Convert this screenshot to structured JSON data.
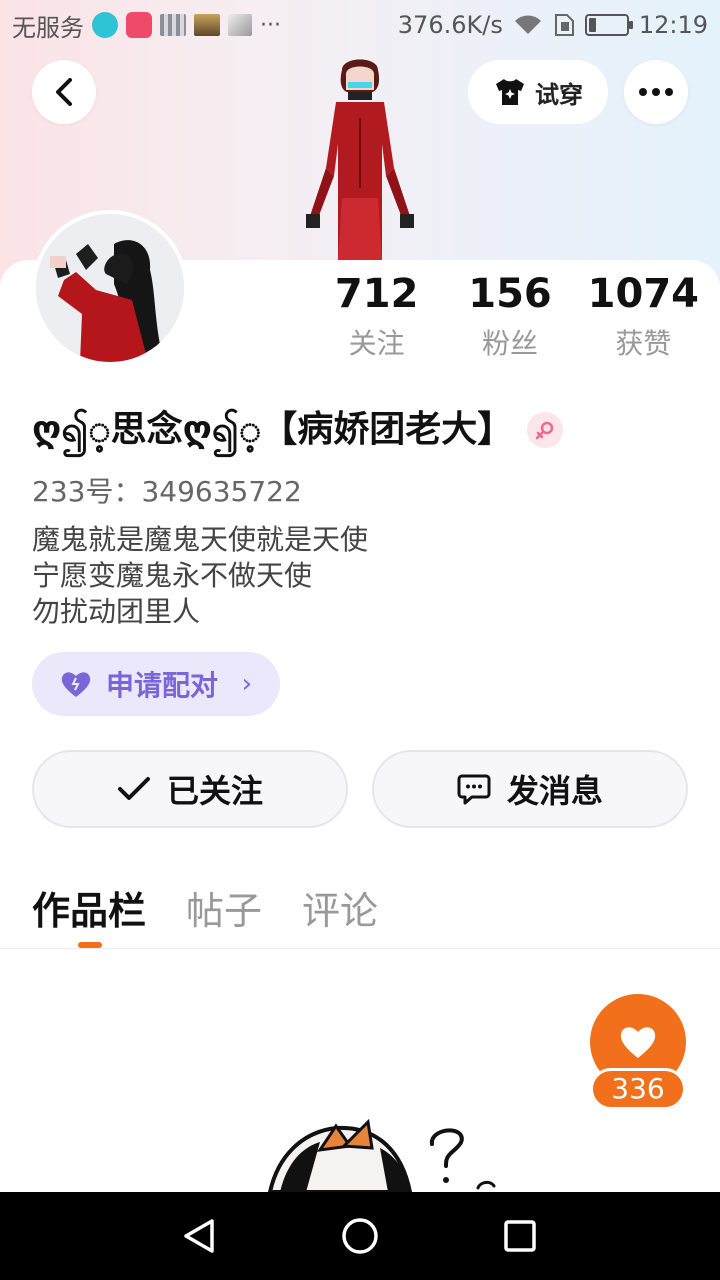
{
  "status_bar": {
    "carrier": "无服务",
    "network_speed": "376.6K/s",
    "time": "12:19",
    "battery_level": 0.2
  },
  "header": {
    "try_on_label": "试穿"
  },
  "profile": {
    "stats": [
      {
        "value": "712",
        "label": "关注"
      },
      {
        "value": "156",
        "label": "粉丝"
      },
      {
        "value": "1074",
        "label": "获赞"
      }
    ],
    "nickname": "ღ၍့思念ღ၍့【病娇团老大】",
    "uid": "233号：349635722",
    "bio": [
      "魔鬼就是魔鬼天使就是天使",
      "宁愿变魔鬼永不做天使",
      "勿扰动团里人"
    ],
    "pair_label": "申请配对"
  },
  "actions": {
    "follow_label": "已关注",
    "message_label": "发消息"
  },
  "tabs": [
    {
      "label": "作品栏",
      "active": true
    },
    {
      "label": "帖子",
      "active": false
    },
    {
      "label": "评论",
      "active": false
    }
  ],
  "likes": {
    "count": "336"
  },
  "colors": {
    "accent": "#f2701c",
    "pair": "#7b66d8"
  }
}
